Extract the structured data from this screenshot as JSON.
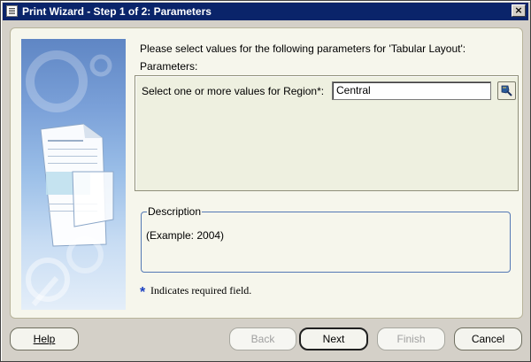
{
  "window": {
    "title": "Print Wizard - Step 1 of 2: Parameters",
    "close_label": "×"
  },
  "main": {
    "intro": "Please select values for the following parameters for 'Tabular Layout':",
    "parameters_label": "Parameters:",
    "region_label": "Select one or more values for Region*:",
    "region_value": "Central"
  },
  "description": {
    "legend": "Description",
    "text": "(Example: 2004)"
  },
  "required": {
    "star": "*",
    "note": "Indicates required field."
  },
  "buttons": {
    "help": "Help",
    "back": "Back",
    "next": "Next",
    "finish": "Finish",
    "cancel": "Cancel"
  },
  "colors": {
    "titlebar": "#0a246a",
    "accent_blue": "#5478b4",
    "required_star": "#1a3fc0"
  }
}
